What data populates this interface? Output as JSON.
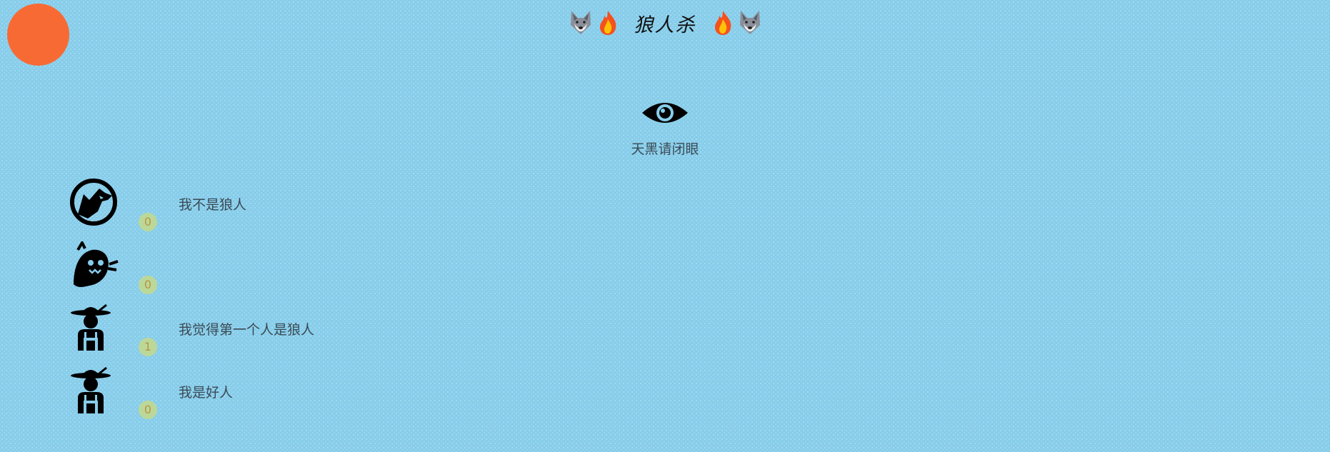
{
  "header": {
    "title": "狼人杀",
    "left_icons": [
      "wolf-icon",
      "fire-icon"
    ],
    "right_icons": [
      "fire-icon",
      "wolf-icon"
    ]
  },
  "phase": {
    "icon": "eye-icon",
    "text": "天黑请闭眼"
  },
  "players": [
    {
      "role_icon": "werewolf-icon",
      "votes": "0",
      "speech": "我不是狼人"
    },
    {
      "role_icon": "ghost-icon",
      "votes": "0",
      "speech": ""
    },
    {
      "role_icon": "farmer-icon",
      "votes": "1",
      "speech": "我觉得第一个人是狼人"
    },
    {
      "role_icon": "farmer-icon",
      "votes": "0",
      "speech": "我是好人"
    }
  ],
  "colors": {
    "background": "#87cdea",
    "orb": "#f86a33",
    "vote_badge": "#bcd898",
    "vote_text": "#b89448"
  }
}
